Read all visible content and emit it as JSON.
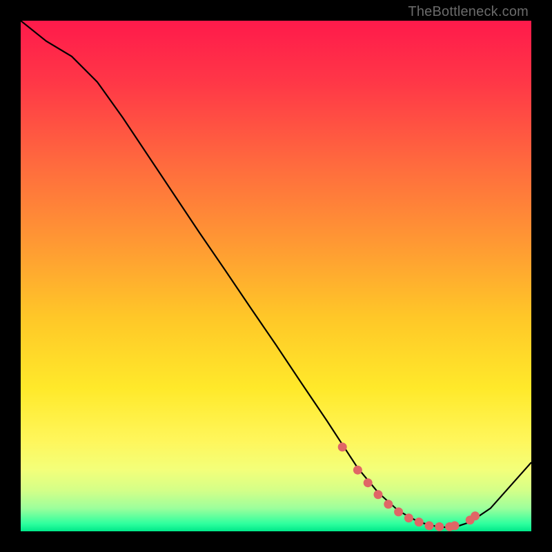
{
  "watermark": "TheBottleneck.com",
  "chart_data": {
    "type": "line",
    "title": "",
    "xlabel": "",
    "ylabel": "",
    "xlim": [
      0,
      100
    ],
    "ylim": [
      0,
      100
    ],
    "series": [
      {
        "name": "curve",
        "x": [
          0,
          5,
          10,
          15,
          20,
          25,
          30,
          35,
          40,
          45,
          50,
          55,
          60,
          63,
          66,
          70,
          74,
          78,
          82,
          85,
          88,
          92,
          100
        ],
        "y": [
          100,
          96,
          93,
          88,
          81,
          73.5,
          66,
          58.5,
          51.2,
          43.8,
          36.5,
          29,
          21.6,
          17,
          12.4,
          7.6,
          4.0,
          1.8,
          0.8,
          0.8,
          1.8,
          4.5,
          13.5
        ]
      }
    ],
    "markers": {
      "name": "dots",
      "color": "#e06666",
      "x": [
        63,
        66,
        68,
        70,
        72,
        74,
        76,
        78,
        80,
        82,
        84,
        85,
        88,
        89
      ],
      "y": [
        16.5,
        12.0,
        9.5,
        7.2,
        5.3,
        3.8,
        2.6,
        1.8,
        1.1,
        0.9,
        0.9,
        1.1,
        2.2,
        3.0
      ]
    },
    "gradient_stops": [
      {
        "offset": 0.0,
        "color": "#ff1a4b"
      },
      {
        "offset": 0.12,
        "color": "#ff3747"
      },
      {
        "offset": 0.28,
        "color": "#ff6a3e"
      },
      {
        "offset": 0.44,
        "color": "#ff9a33"
      },
      {
        "offset": 0.58,
        "color": "#ffc728"
      },
      {
        "offset": 0.72,
        "color": "#ffe92a"
      },
      {
        "offset": 0.82,
        "color": "#fff65a"
      },
      {
        "offset": 0.88,
        "color": "#f3ff7a"
      },
      {
        "offset": 0.92,
        "color": "#d4ff88"
      },
      {
        "offset": 0.955,
        "color": "#9cff9c"
      },
      {
        "offset": 0.985,
        "color": "#2fff9e"
      },
      {
        "offset": 1.0,
        "color": "#00e88a"
      }
    ]
  }
}
